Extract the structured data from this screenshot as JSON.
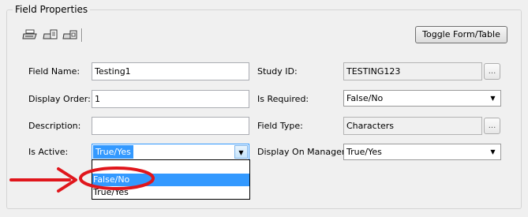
{
  "group": {
    "title": "Field Properties"
  },
  "toolbar": {
    "icons": [
      "print-icon",
      "print-preview-icon",
      "print-setup-icon"
    ],
    "toggle_label": "Toggle Form/Table"
  },
  "fields": {
    "field_name": {
      "label": "Field Name:",
      "value": "Testing1"
    },
    "display_order": {
      "label": "Display Order:",
      "value": "1"
    },
    "description": {
      "label": "Description:",
      "value": ""
    },
    "is_active": {
      "label": "Is Active:",
      "value": "True/Yes",
      "options": [
        "",
        "False/No",
        "True/Yes"
      ],
      "highlighted": "False/No"
    },
    "study_id": {
      "label": "Study ID:",
      "value": "TESTING123",
      "button": "..."
    },
    "is_required": {
      "label": "Is Required:",
      "value": "False/No"
    },
    "field_type": {
      "label": "Field Type:",
      "value": "Characters",
      "button": "..."
    },
    "display_on_manager": {
      "label": "Display On Manager:",
      "value": "True/Yes"
    }
  },
  "colors": {
    "accent": "#3399ff",
    "annotation": "#e0161c"
  }
}
